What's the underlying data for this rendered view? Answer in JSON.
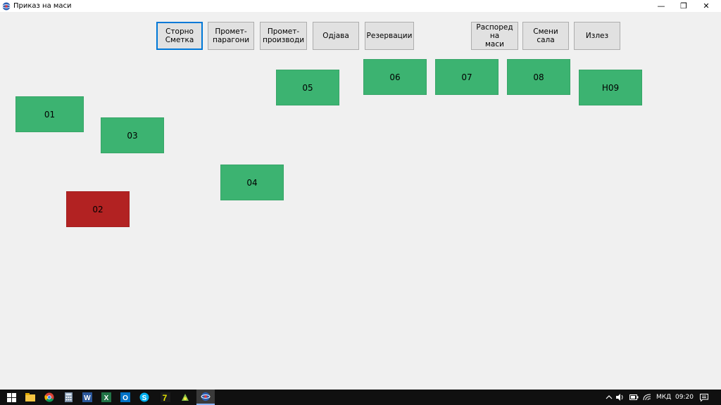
{
  "window": {
    "title": "Приказ на маси",
    "controls": {
      "minimize": "—",
      "restore": "❐",
      "close": "✕"
    }
  },
  "toolbar": {
    "buttons": [
      {
        "label": "Сторно\nСметка",
        "focused": true
      },
      {
        "label": "Промет-\nпарагони"
      },
      {
        "label": "Промет-\nпроизводи"
      },
      {
        "label": "Одјава"
      },
      {
        "label": "Резервации"
      },
      {
        "label": "Распоред на\nмаси"
      },
      {
        "label": "Смени сала"
      },
      {
        "label": "Излез"
      }
    ]
  },
  "tables": [
    {
      "label": "01",
      "status": "free"
    },
    {
      "label": "03",
      "status": "free"
    },
    {
      "label": "04",
      "status": "free"
    },
    {
      "label": "02",
      "status": "occupied"
    },
    {
      "label": "05",
      "status": "free"
    },
    {
      "label": "06",
      "status": "free"
    },
    {
      "label": "07",
      "status": "free"
    },
    {
      "label": "08",
      "status": "free"
    },
    {
      "label": "H09",
      "status": "free"
    }
  ],
  "colors": {
    "free": "#3cb371",
    "occupied": "#b22222",
    "background": "#f0f0f0",
    "focus": "#0078d7"
  },
  "taskbar": {
    "apps": [
      "start-icon",
      "file-explorer-icon",
      "chrome-icon",
      "calculator-icon",
      "word-icon",
      "excel-icon",
      "outlook-icon",
      "skype-icon",
      "7zip-icon",
      "app-icon",
      "pos-app-icon"
    ],
    "tray": {
      "language": "МКД",
      "time": "09:20"
    }
  }
}
